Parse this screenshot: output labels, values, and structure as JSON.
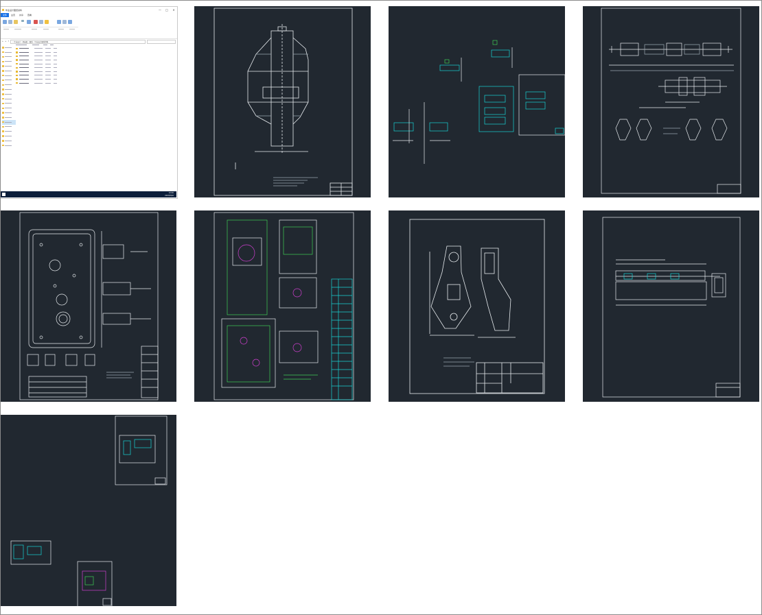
{
  "explorer": {
    "title": "毕业设计图纸资料",
    "tabs": {
      "file": "文件",
      "home": "主页",
      "share": "共享",
      "view": "查看"
    },
    "window_controls": {
      "minimize": "—",
      "maximize": "□",
      "close": "✕"
    },
    "address_path": "› 毕业设计 › 机械类 › 图纸 › 毕业设计图纸资料",
    "status_text": "10 个项目",
    "clock": {
      "time": "12:40",
      "date": "2023/5/10"
    }
  },
  "thumbnails": [
    {
      "name": "drawing-1",
      "kind": "housing-section"
    },
    {
      "name": "drawing-2",
      "kind": "scattered-parts"
    },
    {
      "name": "drawing-3",
      "kind": "screw-assembly"
    },
    {
      "name": "drawing-4",
      "kind": "gearbox-plan"
    },
    {
      "name": "drawing-5",
      "kind": "assembly-with-parts-list"
    },
    {
      "name": "drawing-6",
      "kind": "bracket-part"
    },
    {
      "name": "drawing-7",
      "kind": "long-assembly"
    },
    {
      "name": "drawing-8",
      "kind": "mixed-layout"
    }
  ],
  "colors": {
    "cad_background": "#212830",
    "cad_white": "#e8ecef",
    "cad_cyan": "#18d4d4",
    "cad_green": "#3fcf55",
    "cad_magenta": "#d03fd0",
    "accent": "#1a73e8"
  }
}
